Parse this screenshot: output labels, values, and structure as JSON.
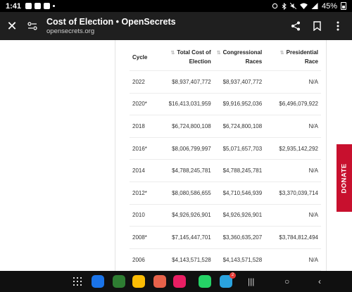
{
  "status_bar": {
    "time": "1:41",
    "battery": "45%"
  },
  "header": {
    "title": "Cost of Election • OpenSecrets",
    "url": "opensecrets.org"
  },
  "table": {
    "headers": [
      "Cycle",
      "Total Cost of Election",
      "Congressional Races",
      "Presidential Race"
    ],
    "rows": [
      [
        "2022",
        "$8,937,407,772",
        "$8,937,407,772",
        "N/A"
      ],
      [
        "2020*",
        "$16,413,031,959",
        "$9,916,952,036",
        "$6,496,079,922"
      ],
      [
        "2018",
        "$6,724,800,108",
        "$6,724,800,108",
        "N/A"
      ],
      [
        "2016*",
        "$8,006,799,997",
        "$5,071,657,703",
        "$2,935,142,292"
      ],
      [
        "2014",
        "$4,788,245,781",
        "$4,788,245,781",
        "N/A"
      ],
      [
        "2012*",
        "$8,080,586,655",
        "$4,710,546,939",
        "$3,370,039,714"
      ],
      [
        "2010",
        "$4,926,926,901",
        "$4,926,926,901",
        "N/A"
      ],
      [
        "2008*",
        "$7,145,447,701",
        "$3,360,635,207",
        "$3,784,812,494"
      ],
      [
        "2006",
        "$4,143,571,528",
        "$4,143,571,528",
        "N/A"
      ]
    ]
  },
  "donate_label": "DONATE",
  "taskbar": {
    "apps": [
      {
        "name": "messages-app-icon",
        "color": "#1a73e8"
      },
      {
        "name": "phone-app-icon",
        "color": "#2e7d32"
      },
      {
        "name": "chrome-app-icon",
        "color": "#fbbc04"
      },
      {
        "name": "contacts-app-icon",
        "color": "#e8624a"
      },
      {
        "name": "screen-recorder-app-icon",
        "color": "#e91e63"
      },
      {
        "name": "whatsapp-app-icon",
        "color": "#25d366"
      },
      {
        "name": "telegram-app-icon",
        "color": "#2aa3df"
      }
    ],
    "telegram_badge": "2"
  }
}
